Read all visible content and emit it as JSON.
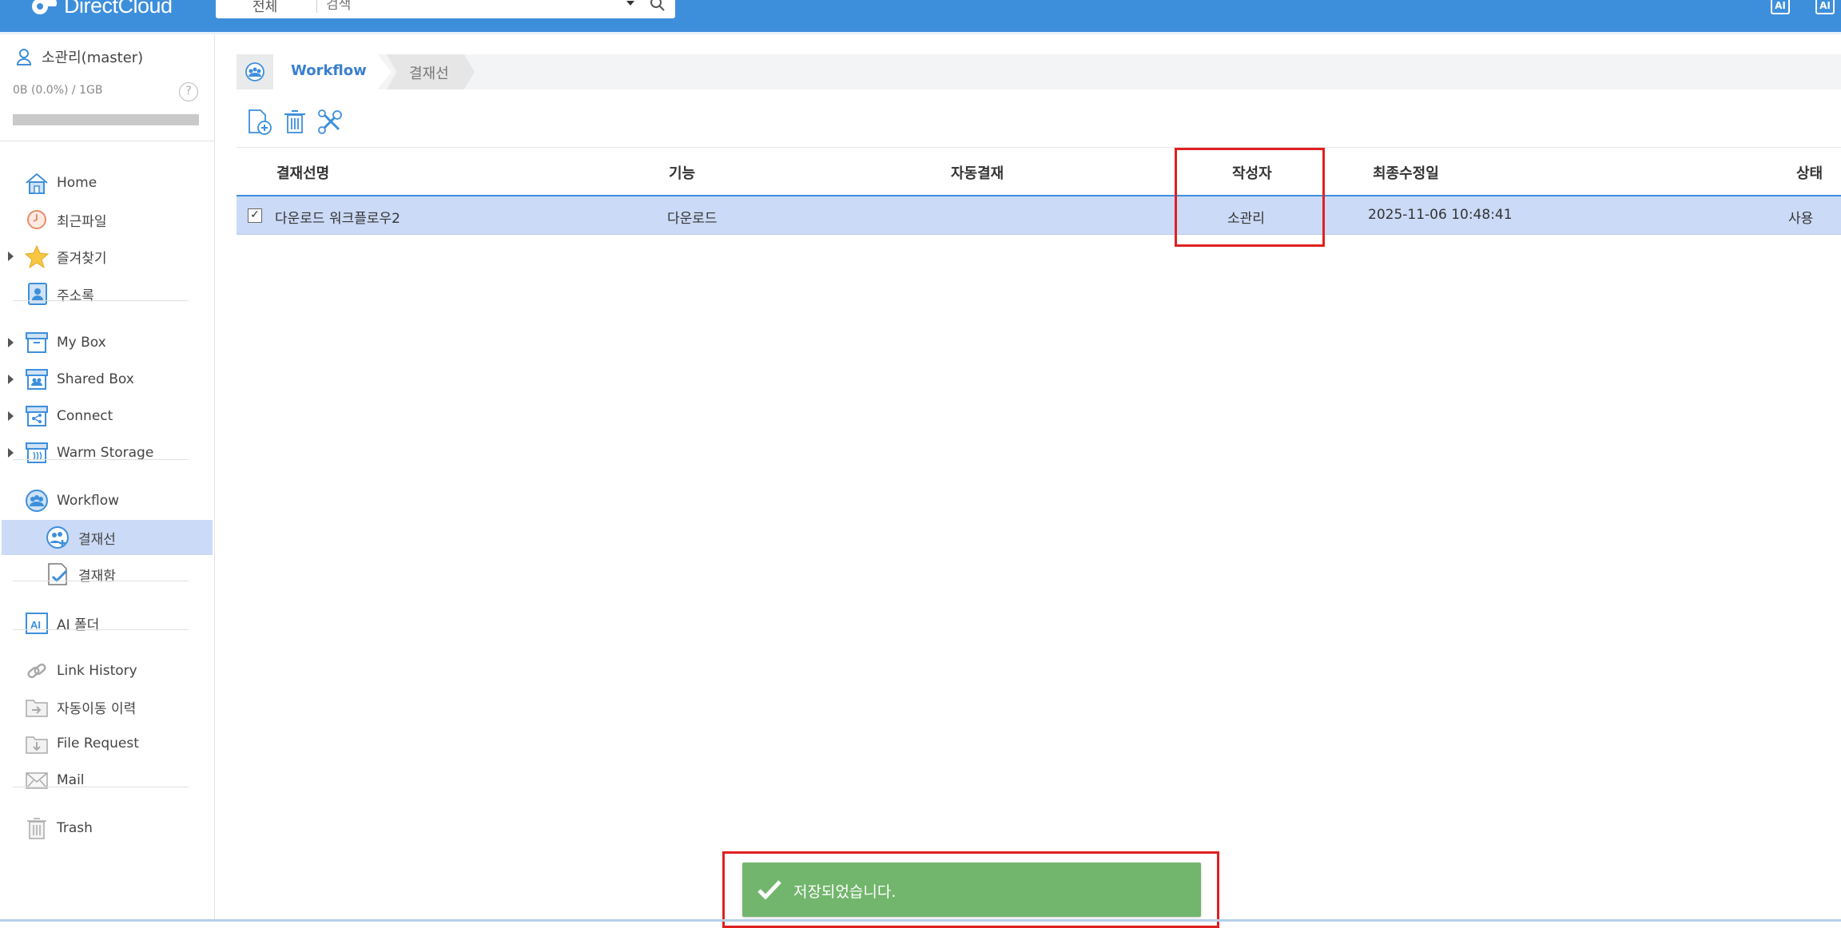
{
  "app": {
    "brand": "DirectCloud",
    "brand_color": "#3d8fdc",
    "top_icons": [
      "AI",
      "AI"
    ]
  },
  "search": {
    "scope": "전체",
    "placeholder": "검색"
  },
  "sidebar": {
    "user_name": "소관리(master)",
    "quota_text": "0B (0.0%) / 1GB",
    "quota_percent": 0.0,
    "help": "?",
    "items": [
      {
        "label": "Home",
        "icon": "home-icon"
      },
      {
        "label": "최근파일",
        "icon": "clock-icon"
      },
      {
        "label": "즐겨찾기",
        "icon": "star-icon"
      },
      {
        "label": "주소록",
        "icon": "contact-icon"
      },
      {
        "label": "My Box",
        "icon": "box-icon"
      },
      {
        "label": "Shared Box",
        "icon": "shared-box-icon"
      },
      {
        "label": "Connect",
        "icon": "connect-icon"
      },
      {
        "label": "Warm Storage",
        "icon": "warm-storage-icon"
      },
      {
        "label": "Workflow",
        "icon": "workflow-icon"
      },
      {
        "label": "결재선",
        "icon": "approval-line-icon"
      },
      {
        "label": "결재함",
        "icon": "approval-box-icon"
      },
      {
        "label": "AI 폴더",
        "icon": "ai-folder-icon"
      },
      {
        "label": "Link History",
        "icon": "link-icon"
      },
      {
        "label": "자동이동 이력",
        "icon": "auto-move-icon"
      },
      {
        "label": "File Request",
        "icon": "file-request-icon"
      },
      {
        "label": "Mail",
        "icon": "mail-icon"
      },
      {
        "label": "Trash",
        "icon": "trash-icon"
      }
    ]
  },
  "breadcrumb": {
    "root": "Workflow",
    "current": "결재선"
  },
  "toolbar": {
    "add": "add-document-icon",
    "delete": "delete-icon",
    "settings": "tools-icon"
  },
  "table": {
    "columns": [
      "결재선명",
      "기능",
      "자동결재",
      "작성자",
      "최종수정일",
      "상태"
    ],
    "rows": [
      {
        "checked": true,
        "check_mark": "✓",
        "name": "다운로드 워크플로우2",
        "function": "다운로드",
        "auto_approval": "",
        "author": "소관리",
        "modified": "2025-11-06 10:48:41",
        "status": "사용"
      }
    ]
  },
  "toast": {
    "message": "저장되었습니다.",
    "color": "#72b56d"
  },
  "highlight_color": "#e02020"
}
